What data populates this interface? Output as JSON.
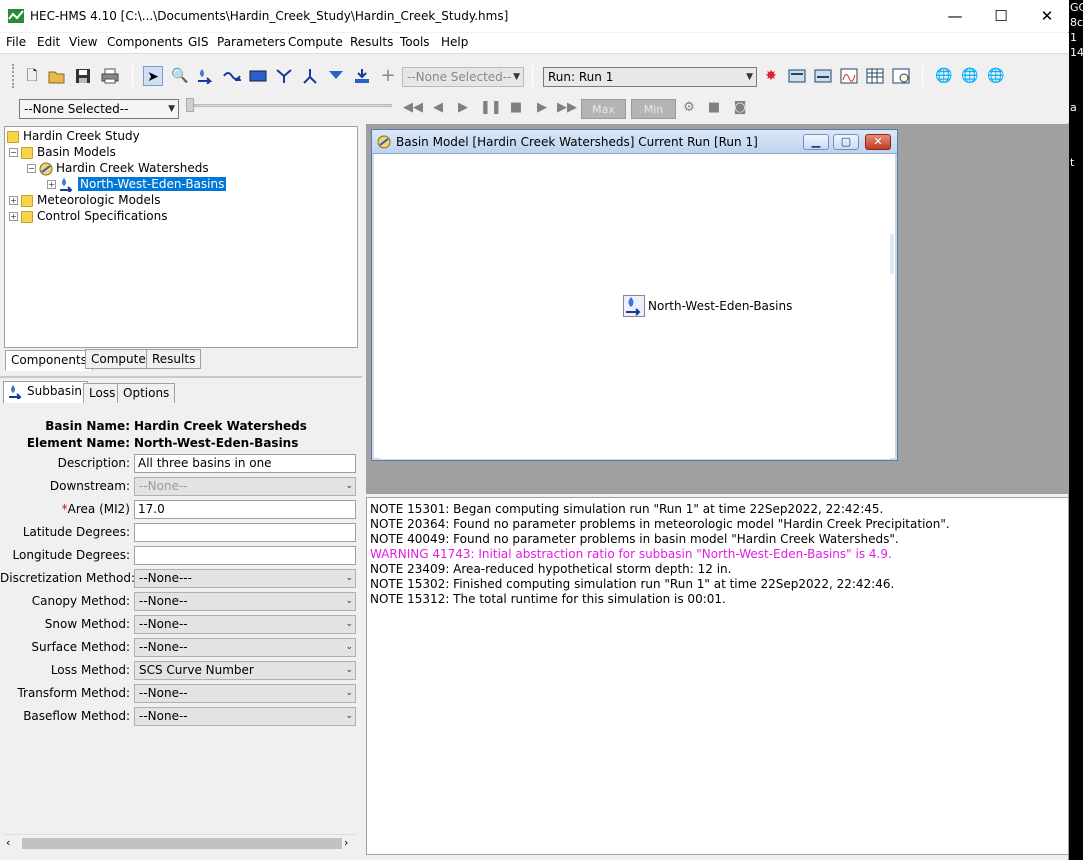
{
  "window": {
    "title": "HEC-HMS 4.10 [C:\\...\\Documents\\Hardin_Creek_Study\\Hardin_Creek_Study.hms]",
    "minimize": "—",
    "maximize": "☐",
    "close": "✕"
  },
  "desktop_edge": [
    "GC",
    "8c",
    "1",
    "14",
    "a",
    "t"
  ],
  "menu": [
    "File",
    "Edit",
    "View",
    "Components",
    "GIS",
    "Parameters",
    "Compute",
    "Results",
    "Tools",
    "Help"
  ],
  "toolbar": {
    "element_select": "--None Selected--",
    "run_select": "Run: Run 1",
    "time_select": "--None Selected--",
    "max_label": "Max",
    "min_label": "Min"
  },
  "tree": {
    "root": "Hardin Creek Study",
    "basin_models": "Basin Models",
    "basin": "Hardin Creek Watersheds",
    "subbasin": "North-West-Eden-Basins",
    "met_models": "Meteorologic Models",
    "control_specs": "Control Specifications"
  },
  "panel_tabs": [
    "Components",
    "Compute",
    "Results"
  ],
  "editor_tabs": [
    "Subbasin",
    "Loss",
    "Options"
  ],
  "editor": {
    "basin_name_label": "Basin Name:",
    "basin_name": "Hardin Creek Watersheds",
    "element_name_label": "Element Name:",
    "element_name": "North-West-Eden-Basins",
    "fields": [
      {
        "label": "Description:",
        "value": "All three basins in one",
        "kind": "input"
      },
      {
        "label": "Downstream:",
        "value": "--None--",
        "kind": "select-disabled"
      },
      {
        "label": "Area (MI2)",
        "required": "*",
        "value": "17.0",
        "kind": "input"
      },
      {
        "label": "Latitude Degrees:",
        "value": "",
        "kind": "input"
      },
      {
        "label": "Longitude Degrees:",
        "value": "",
        "kind": "input"
      },
      {
        "label": "Discretization Method:",
        "value": "--None---",
        "kind": "select"
      },
      {
        "label": "Canopy Method:",
        "value": "--None--",
        "kind": "select"
      },
      {
        "label": "Snow Method:",
        "value": "--None--",
        "kind": "select"
      },
      {
        "label": "Surface Method:",
        "value": "--None--",
        "kind": "select"
      },
      {
        "label": "Loss Method:",
        "value": "SCS Curve Number",
        "kind": "select"
      },
      {
        "label": "Transform Method:",
        "value": "--None--",
        "kind": "select"
      },
      {
        "label": "Baseflow Method:",
        "value": "--None--",
        "kind": "select"
      }
    ]
  },
  "basin_window": {
    "title": "Basin Model [Hardin Creek Watersheds] Current Run [Run 1]",
    "element_label": "North-West-Eden-Basins"
  },
  "log": [
    {
      "text": "NOTE 15301:  Began computing simulation run \"Run 1\" at time 22Sep2022, 22:42:45.",
      "level": "note"
    },
    {
      "text": "NOTE 20364:  Found no parameter problems in meteorologic model \"Hardin Creek Precipitation\".",
      "level": "note"
    },
    {
      "text": "NOTE 40049:  Found no parameter problems in basin model \"Hardin Creek Watersheds\".",
      "level": "note"
    },
    {
      "text": "WARNING 41743:  Initial abstraction ratio for subbasin \"North-West-Eden-Basins\" is 4.9.",
      "level": "warning"
    },
    {
      "text": "NOTE 23409:  Area-reduced hypothetical storm depth: 12 in.",
      "level": "note"
    },
    {
      "text": "NOTE 15302:  Finished computing simulation run \"Run 1\" at time 22Sep2022, 22:42:46.",
      "level": "note"
    },
    {
      "text": "NOTE 15312:  The total runtime for this simulation is 00:01.",
      "level": "note"
    }
  ],
  "colors": {
    "warning": "#e020e0",
    "selection": "#0078d7"
  }
}
